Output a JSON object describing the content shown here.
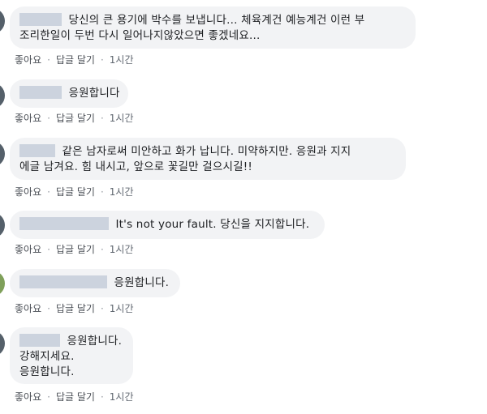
{
  "comments": [
    {
      "lines": [
        "당신의 큰 용기에 박수를 보냅니다... 체육계건 예능계건 이런 부",
        "조리한일이 두번 다시 일어나지않았으면 좋겠네요..."
      ],
      "actions": {
        "like": "좋아요",
        "reply": "답글 달기",
        "time": "1시간"
      }
    },
    {
      "lines": [
        "응원합니다"
      ],
      "actions": {
        "like": "좋아요",
        "reply": "답글 달기",
        "time": "1시간"
      }
    },
    {
      "lines": [
        "같은 남자로써 미안하고 화가 납니다. 미약하지만. 응원과 지지",
        "에글 남겨요. 힘 내시고, 앞으로 꽃길만 걸으시길!!"
      ],
      "actions": {
        "like": "좋아요",
        "reply": "답글 달기",
        "time": "1시간"
      }
    },
    {
      "lines": [
        "It's not your fault. 당신을 지지합니다."
      ],
      "actions": {
        "like": "좋아요",
        "reply": "답글 달기",
        "time": "1시간"
      }
    },
    {
      "lines": [
        "응원합니다."
      ],
      "actions": {
        "like": "좋아요",
        "reply": "답글 달기",
        "time": "1시간"
      }
    },
    {
      "lines": [
        "응원합니다.",
        "강해지세요.",
        "응원합니다."
      ],
      "actions": {
        "like": "좋아요",
        "reply": "답글 달기",
        "time": "1시간"
      }
    }
  ],
  "colors": {
    "bubble": "#f2f3f5",
    "name_redaction": "#ccd3de",
    "action_text": "#606770"
  }
}
